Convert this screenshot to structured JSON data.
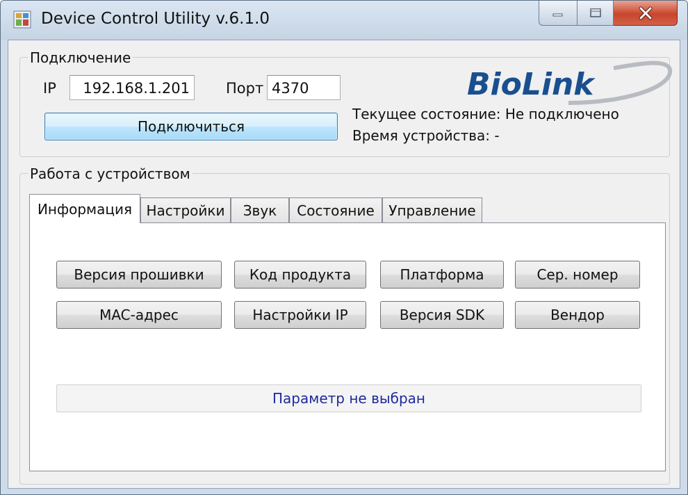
{
  "window": {
    "title": "Device Control Utility v.6.1.0",
    "icon": "app-window-icon",
    "caption_buttons": [
      "minimize-icon",
      "maximize-icon",
      "close-icon"
    ]
  },
  "connection": {
    "group_label": "Подключение",
    "ip_label": "IP",
    "ip_value": "192.168.1.201",
    "port_label": "Порт",
    "port_value": "4370",
    "connect_button": "Подключиться",
    "state_text": "Текущее состояние: Не подключено",
    "device_time_text": "Время устройства: -"
  },
  "logo": {
    "text": "BioLink",
    "color": "#1a4f8f"
  },
  "device_work": {
    "group_label": "Работа с устройством",
    "tabs": [
      {
        "label": "Информация",
        "active": true
      },
      {
        "label": "Настройки",
        "active": false
      },
      {
        "label": "Звук",
        "active": false
      },
      {
        "label": "Состояние",
        "active": false
      },
      {
        "label": "Управление",
        "active": false
      }
    ],
    "buttons": [
      "Версия прошивки",
      "Код продукта",
      "Платформа",
      "Сер. номер",
      "MAC-адрес",
      "Настройки IP",
      "Версия SDK",
      "Вендор"
    ],
    "parameter_text": "Параметр не выбран"
  },
  "colors": {
    "accent": "#3c7fb1",
    "parameter_text": "#1e2a9c",
    "close_button": "#c9452b"
  }
}
